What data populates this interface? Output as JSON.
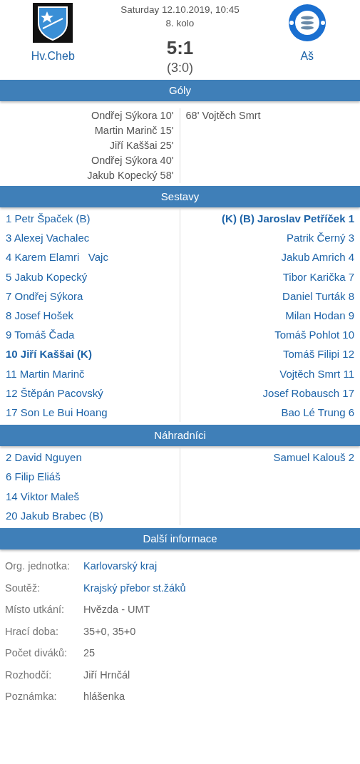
{
  "match": {
    "home": {
      "name": "Hv.Cheb"
    },
    "away": {
      "name": "Aš"
    },
    "date": "Saturday 12.10.2019, 10:45",
    "round": "8. kolo",
    "score": "5:1",
    "halftime": "(3:0)"
  },
  "goals": {
    "title": "Góly",
    "home": [
      "Ondřej Sýkora 10'",
      "Martin Marinč 15'",
      "Jiří Kaššai 25'",
      "Ondřej Sýkora 40'",
      "Jakub Kopecký 58'"
    ],
    "away": [
      "68' Vojtěch Smrt"
    ]
  },
  "lineups": {
    "title": "Sestavy",
    "home": [
      {
        "name": "1 Petr Špaček (B)",
        "bold": false
      },
      {
        "name": "3 Alexej Vachalec",
        "bold": false
      },
      {
        "name": "4 Karem Elamri   Vajc",
        "bold": false
      },
      {
        "name": "5 Jakub Kopecký",
        "bold": false
      },
      {
        "name": "7 Ondřej Sýkora",
        "bold": false
      },
      {
        "name": "8 Josef Hošek",
        "bold": false
      },
      {
        "name": "9 Tomáš Čada",
        "bold": false
      },
      {
        "name": "10 Jiří Kaššai (K)",
        "bold": true
      },
      {
        "name": "11 Martin Marinč",
        "bold": false
      },
      {
        "name": "12 Štěpán Pacovský",
        "bold": false
      },
      {
        "name": "17 Son Le Bui Hoang",
        "bold": false
      }
    ],
    "away": [
      {
        "name": "(K) (B) Jaroslav Petříček 1",
        "bold": true
      },
      {
        "name": "Patrik Černý 3",
        "bold": false
      },
      {
        "name": "Jakub Amrich 4",
        "bold": false
      },
      {
        "name": "Tibor Karička 7",
        "bold": false
      },
      {
        "name": "Daniel Turták 8",
        "bold": false
      },
      {
        "name": "Milan Hodan 9",
        "bold": false
      },
      {
        "name": "Tomáš Pohlot 10",
        "bold": false
      },
      {
        "name": "Tomáš Filipi 12",
        "bold": false
      },
      {
        "name": "Vojtěch Smrt 11",
        "bold": false
      },
      {
        "name": "Josef Robausch 17",
        "bold": false
      },
      {
        "name": "Bao Lé Trung 6",
        "bold": false
      }
    ]
  },
  "substitutes": {
    "title": "Náhradníci",
    "home": [
      {
        "name": "2 David Nguyen",
        "bold": false
      },
      {
        "name": "6 Filip Eliáš",
        "bold": false
      },
      {
        "name": "14 Viktor Maleš",
        "bold": false
      },
      {
        "name": "20 Jakub Brabec (B)",
        "bold": false
      }
    ],
    "away": [
      {
        "name": "Samuel Kalouš 2",
        "bold": false
      }
    ]
  },
  "info": {
    "title": "Další informace",
    "rows": [
      {
        "label": "Org. jednotka:",
        "value": "Karlovarský kraj",
        "link": true
      },
      {
        "label": "Soutěž:",
        "value": "Krajský přebor st.žáků",
        "link": true
      },
      {
        "label": "Místo utkání:",
        "value": "Hvězda - UMT",
        "link": false
      },
      {
        "label": "Hrací doba:",
        "value": "35+0, 35+0",
        "link": false
      },
      {
        "label": "Počet diváků:",
        "value": "25",
        "link": false
      },
      {
        "label": "Rozhodčí:",
        "value": "Jiří Hrnčál",
        "link": false
      },
      {
        "label": "Poznámka:",
        "value": "hlášenka",
        "link": false
      }
    ]
  }
}
